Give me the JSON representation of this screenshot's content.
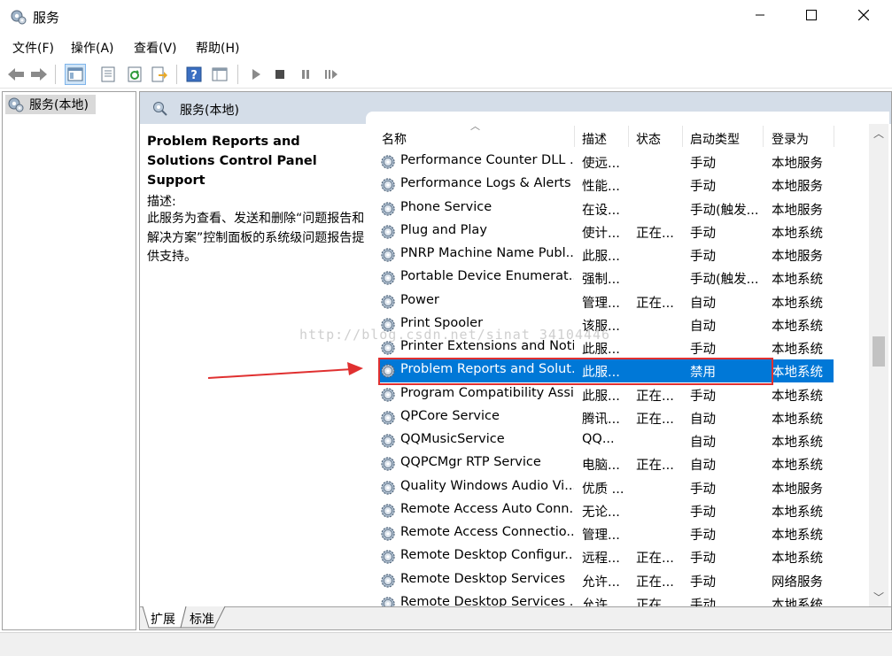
{
  "window": {
    "title": "服务"
  },
  "menu": [
    "文件(F)",
    "操作(A)",
    "查看(V)",
    "帮助(H)"
  ],
  "tree": {
    "node": "服务(本地)"
  },
  "panel": {
    "title": "服务(本地)"
  },
  "description": {
    "service_title": "Problem Reports and Solutions Control Panel Support",
    "label": "描述:",
    "text": "此服务为查看、发送和删除“问题报告和解决方案”控制面板的系统级问题报告提供支持。"
  },
  "columns": {
    "name": "名称",
    "desc": "描述",
    "status": "状态",
    "startup": "启动类型",
    "logon": "登录为"
  },
  "services": [
    {
      "name": "Performance Counter DLL ...",
      "desc": "使远...",
      "status": "",
      "startup": "手动",
      "logon": "本地服务"
    },
    {
      "name": "Performance Logs & Alerts",
      "desc": "性能...",
      "status": "",
      "startup": "手动",
      "logon": "本地服务"
    },
    {
      "name": "Phone Service",
      "desc": "在设...",
      "status": "",
      "startup": "手动(触发...",
      "logon": "本地服务"
    },
    {
      "name": "Plug and Play",
      "desc": "使计...",
      "status": "正在...",
      "startup": "手动",
      "logon": "本地系统"
    },
    {
      "name": "PNRP Machine Name Publ...",
      "desc": "此服...",
      "status": "",
      "startup": "手动",
      "logon": "本地服务"
    },
    {
      "name": "Portable Device Enumerat...",
      "desc": "强制...",
      "status": "",
      "startup": "手动(触发...",
      "logon": "本地系统"
    },
    {
      "name": "Power",
      "desc": "管理...",
      "status": "正在...",
      "startup": "自动",
      "logon": "本地系统"
    },
    {
      "name": "Print Spooler",
      "desc": "该服...",
      "status": "",
      "startup": "自动",
      "logon": "本地系统"
    },
    {
      "name": "Printer Extensions and Noti...",
      "desc": "此服...",
      "status": "",
      "startup": "手动",
      "logon": "本地系统"
    },
    {
      "name": "Problem Reports and Solut...",
      "desc": "此服...",
      "status": "",
      "startup": "禁用",
      "logon": "本地系统",
      "selected": true
    },
    {
      "name": "Program Compatibility Assi...",
      "desc": "此服...",
      "status": "正在...",
      "startup": "手动",
      "logon": "本地系统"
    },
    {
      "name": "QPCore Service",
      "desc": "腾讯...",
      "status": "正在...",
      "startup": "自动",
      "logon": "本地系统"
    },
    {
      "name": "QQMusicService",
      "desc": "QQ...",
      "status": "",
      "startup": "自动",
      "logon": "本地系统"
    },
    {
      "name": "QQPCMgr RTP Service",
      "desc": "电脑...",
      "status": "正在...",
      "startup": "自动",
      "logon": "本地系统"
    },
    {
      "name": "Quality Windows Audio Vi...",
      "desc": "优质 ...",
      "status": "",
      "startup": "手动",
      "logon": "本地服务"
    },
    {
      "name": "Remote Access Auto Conn...",
      "desc": "无论...",
      "status": "",
      "startup": "手动",
      "logon": "本地系统"
    },
    {
      "name": "Remote Access Connectio...",
      "desc": "管理...",
      "status": "",
      "startup": "手动",
      "logon": "本地系统"
    },
    {
      "name": "Remote Desktop Configur...",
      "desc": "远程...",
      "status": "正在...",
      "startup": "手动",
      "logon": "本地系统"
    },
    {
      "name": "Remote Desktop Services",
      "desc": "允许...",
      "status": "正在...",
      "startup": "手动",
      "logon": "网络服务"
    },
    {
      "name": "Remote Desktop Services ...",
      "desc": "允许...",
      "status": "正在...",
      "startup": "手动",
      "logon": "本地系统"
    }
  ],
  "tabs": [
    "扩展",
    "标准"
  ],
  "watermark": "http://blog.csdn.net/sinat_34104446",
  "colors": {
    "selection": "#0078d7",
    "annotation": "#e03030",
    "header": "#d4dde8"
  },
  "icons": [
    "gear-icon",
    "back-icon",
    "forward-icon",
    "console-tree-icon",
    "properties-icon",
    "refresh-icon",
    "export-icon",
    "help-icon",
    "view-icon",
    "play-icon",
    "stop-icon",
    "pause-icon",
    "restart-icon"
  ]
}
